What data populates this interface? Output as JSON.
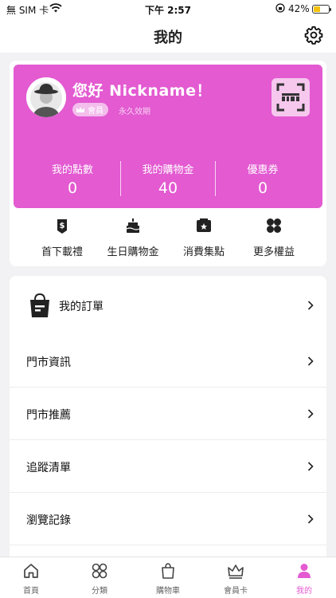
{
  "status_bar": {
    "carrier": "無 SIM 卡",
    "time": "下午 2:57",
    "battery": "42%",
    "battery_level": 0.42
  },
  "header": {
    "title": "我的",
    "settings_icon": "gear-icon"
  },
  "member": {
    "greeting": "您好 Nickname！",
    "level": "會員",
    "validity": "永久效期",
    "qr_icon": "qr-scan-icon",
    "stats": [
      {
        "label": "我的點數",
        "value": "0"
      },
      {
        "label": "我的購物金",
        "value": "40"
      },
      {
        "label": "優惠券",
        "value": "0"
      }
    ],
    "card_color": "#e35ad1"
  },
  "perks": [
    {
      "label": "首下載禮",
      "icon": "money-bag-icon"
    },
    {
      "label": "生日購物金",
      "icon": "birthday-cake-icon"
    },
    {
      "label": "消費集點",
      "icon": "stamp-card-icon"
    },
    {
      "label": "更多權益",
      "icon": "more-grid-icon"
    }
  ],
  "menu": [
    {
      "label": "我的訂單",
      "icon": "shopping-bag-icon"
    },
    {
      "label": "門市資訊"
    },
    {
      "label": "門市推薦"
    },
    {
      "label": "追蹤清單"
    },
    {
      "label": "瀏覽記錄"
    }
  ],
  "tabs": [
    {
      "label": "首頁",
      "icon": "home-icon"
    },
    {
      "label": "分類",
      "icon": "category-icon"
    },
    {
      "label": "購物車",
      "icon": "cart-icon"
    },
    {
      "label": "會員卡",
      "icon": "crown-icon"
    },
    {
      "label": "我的",
      "icon": "person-icon",
      "active": true
    }
  ],
  "accent_color": "#e35ad1"
}
